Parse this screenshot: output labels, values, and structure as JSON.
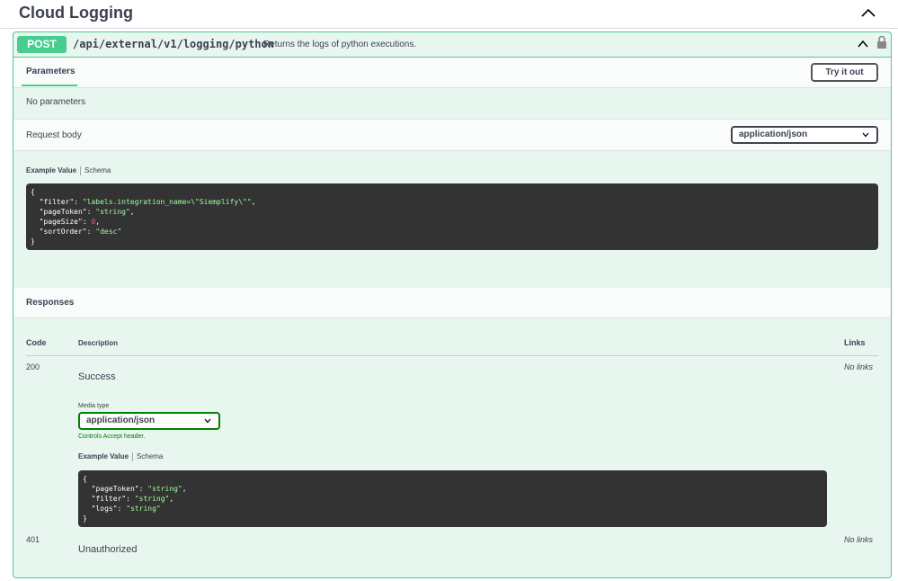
{
  "section": {
    "title": "Cloud Logging"
  },
  "operation": {
    "method": "POST",
    "path": "/api/external/v1/logging/python",
    "summary": "Returns the logs of python executions."
  },
  "parameters": {
    "tab_label": "Parameters",
    "try_label": "Try it out",
    "empty_text": "No parameters"
  },
  "request_body": {
    "label": "Request body",
    "content_type": "application/json",
    "example_tab": "Example Value",
    "schema_tab": "Schema",
    "example": {
      "open": "{",
      "close": "}",
      "lines": [
        {
          "key": "\"filter\"",
          "value": "\"labels.integration_name=\\\"Siemplify\\\"\"",
          "kind": "string",
          "comma": ","
        },
        {
          "key": "\"pageToken\"",
          "value": "\"string\"",
          "kind": "string",
          "comma": ","
        },
        {
          "key": "\"pageSize\"",
          "value": "0",
          "kind": "number",
          "comma": ","
        },
        {
          "key": "\"sortOrder\"",
          "value": "\"desc\"",
          "kind": "string",
          "comma": ""
        }
      ]
    }
  },
  "responses": {
    "title": "Responses",
    "columns": {
      "code": "Code",
      "description": "Description",
      "links": "Links"
    },
    "items": [
      {
        "code": "200",
        "description": "Success",
        "links": "No links",
        "media_type_label": "Media type",
        "media_type": "application/json",
        "accept_note": "Controls Accept header.",
        "example_tab": "Example Value",
        "schema_tab": "Schema",
        "example": {
          "open": "{",
          "close": "}",
          "lines": [
            {
              "key": "\"pageToken\"",
              "value": "\"string\"",
              "kind": "string",
              "comma": ","
            },
            {
              "key": "\"filter\"",
              "value": "\"string\"",
              "kind": "string",
              "comma": ","
            },
            {
              "key": "\"logs\"",
              "value": "\"string\"",
              "kind": "string",
              "comma": ""
            }
          ]
        }
      },
      {
        "code": "401",
        "description": "Unauthorized",
        "links": "No links"
      }
    ]
  },
  "icons": {
    "collapse": "chevron-up-icon",
    "lock": "lock-icon",
    "select": "chevron-down-icon"
  },
  "colors": {
    "post": "#49cc90",
    "post_bg": "#e8f6f0",
    "code_bg": "#333333",
    "string": "#a2fca2",
    "number": "#d36363"
  }
}
